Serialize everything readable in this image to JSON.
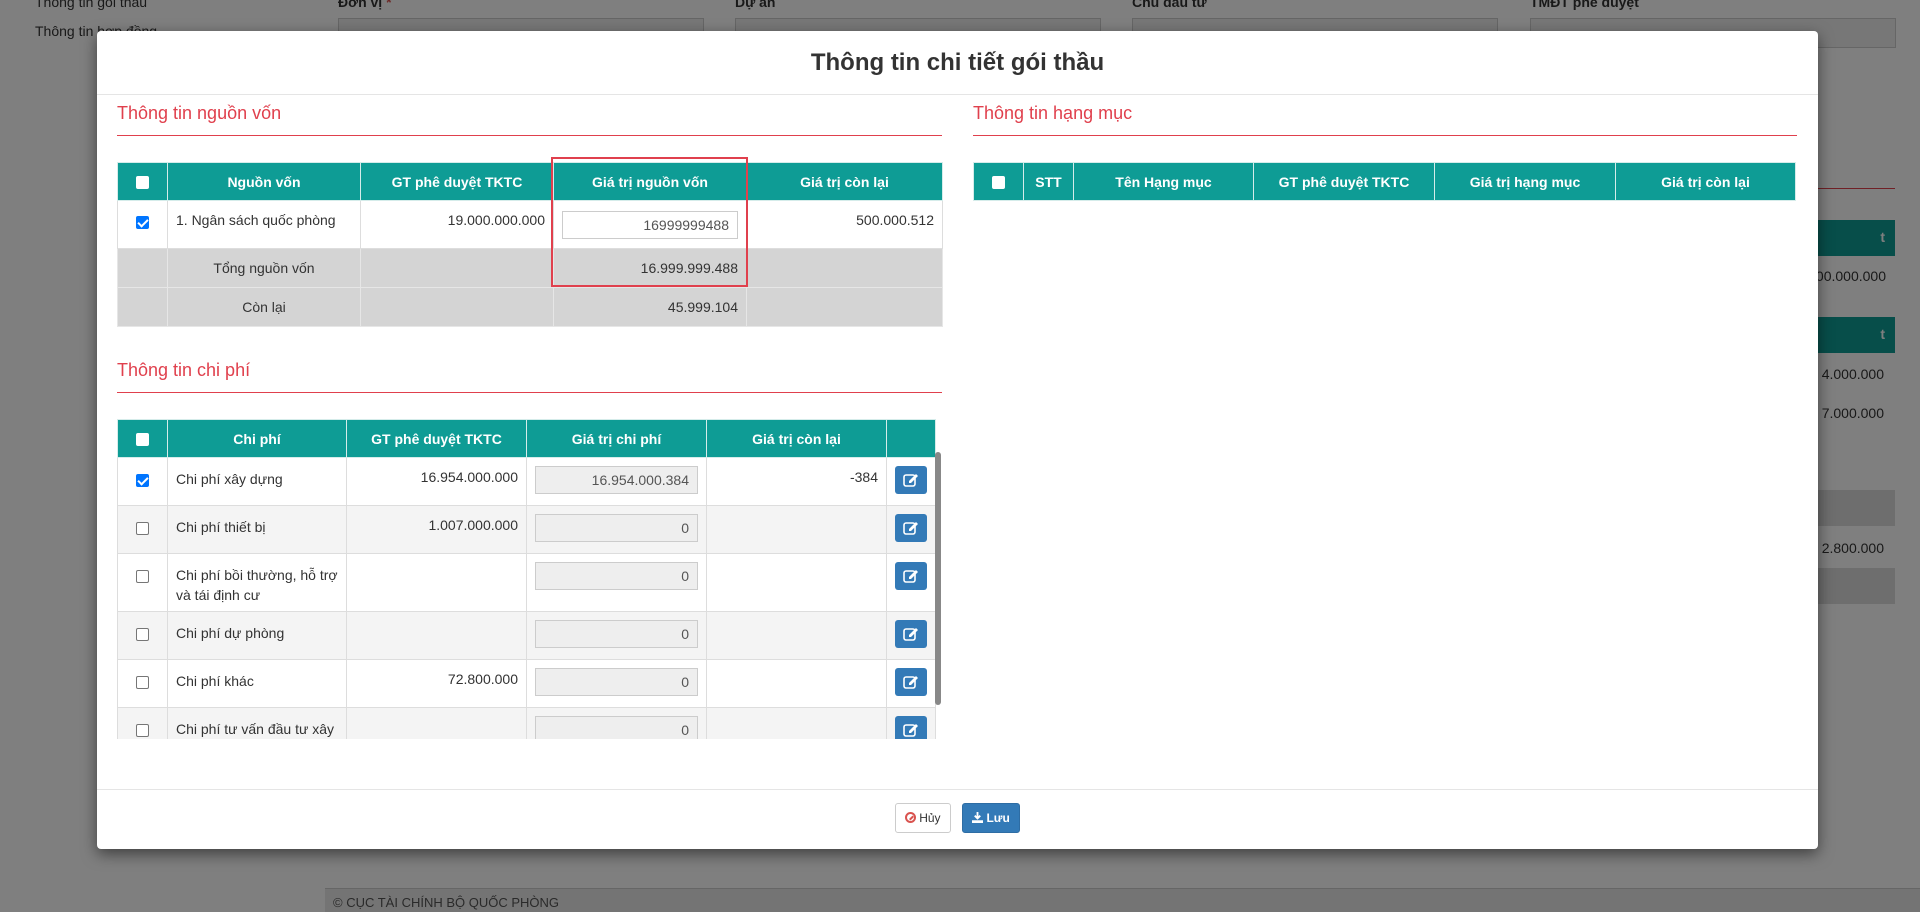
{
  "background": {
    "nav_items": [
      "Thông tin gói thầu",
      "Thông tin hợp đồng"
    ],
    "fields": [
      {
        "label": "Đơn vị",
        "required": true
      },
      {
        "label": "Dự án",
        "required": false
      },
      {
        "label": "Chủ đầu tư",
        "required": false
      },
      {
        "label": "TMĐT phê duyệt",
        "required": false
      }
    ],
    "required_mark": "*",
    "right_header_1": "t",
    "right_header_2": "t",
    "right_values": [
      "00.000.000",
      "4.000.000",
      "7.000.000",
      "2.800.000"
    ],
    "footer_text": "© CỤC TÀI CHÍNH BỘ QUỐC PHÒNG"
  },
  "modal": {
    "title": "Thông tin chi tiết gói thầu",
    "cancel_label": "Hủy",
    "save_label": "Lưu"
  },
  "nguon_von": {
    "section_title": "Thông tin nguồn vốn",
    "headers": [
      "Nguồn vốn",
      "GT phê duyệt TKTC",
      "Giá trị nguồn vốn",
      "Giá trị còn lại"
    ],
    "rows": [
      {
        "checked": true,
        "name": "1. Ngân sách quốc phòng",
        "gt_phe_duyet": "19.000.000.000",
        "gia_tri_input": "16999999488",
        "con_lai": "500.000.512"
      }
    ],
    "total_label": "Tổng nguồn vốn",
    "total_value": "16.999.999.488",
    "remaining_label": "Còn lại",
    "remaining_value": "45.999.104"
  },
  "hang_muc": {
    "section_title": "Thông tin hạng mục",
    "headers": [
      "STT",
      "Tên Hạng mục",
      "GT phê duyệt TKTC",
      "Giá trị hạng mục",
      "Giá trị còn lại"
    ]
  },
  "chi_phi": {
    "section_title": "Thông tin chi phí",
    "headers": [
      "Chi phí",
      "GT phê duyệt TKTC",
      "Giá trị chi phí",
      "Giá trị còn lại"
    ],
    "rows": [
      {
        "checked": true,
        "name": "Chi phí xây dựng",
        "gt_phe_duyet": "16.954.000.000",
        "gia_tri": "16.954.000.384",
        "con_lai": "-384"
      },
      {
        "checked": false,
        "name": "Chi phí thiết bị",
        "gt_phe_duyet": "1.007.000.000",
        "gia_tri": "0",
        "con_lai": ""
      },
      {
        "checked": false,
        "name": "Chi phí bồi thường, hỗ trợ và tái định cư",
        "gt_phe_duyet": "",
        "gia_tri": "0",
        "con_lai": ""
      },
      {
        "checked": false,
        "name": "Chi phí dự phòng",
        "gt_phe_duyet": "",
        "gia_tri": "0",
        "con_lai": ""
      },
      {
        "checked": false,
        "name": "Chi phí khác",
        "gt_phe_duyet": "72.800.000",
        "gia_tri": "0",
        "con_lai": ""
      },
      {
        "checked": false,
        "name": "Chi phí tư vấn đầu tư xây",
        "gt_phe_duyet": "",
        "gia_tri": "0",
        "con_lai": ""
      }
    ]
  }
}
